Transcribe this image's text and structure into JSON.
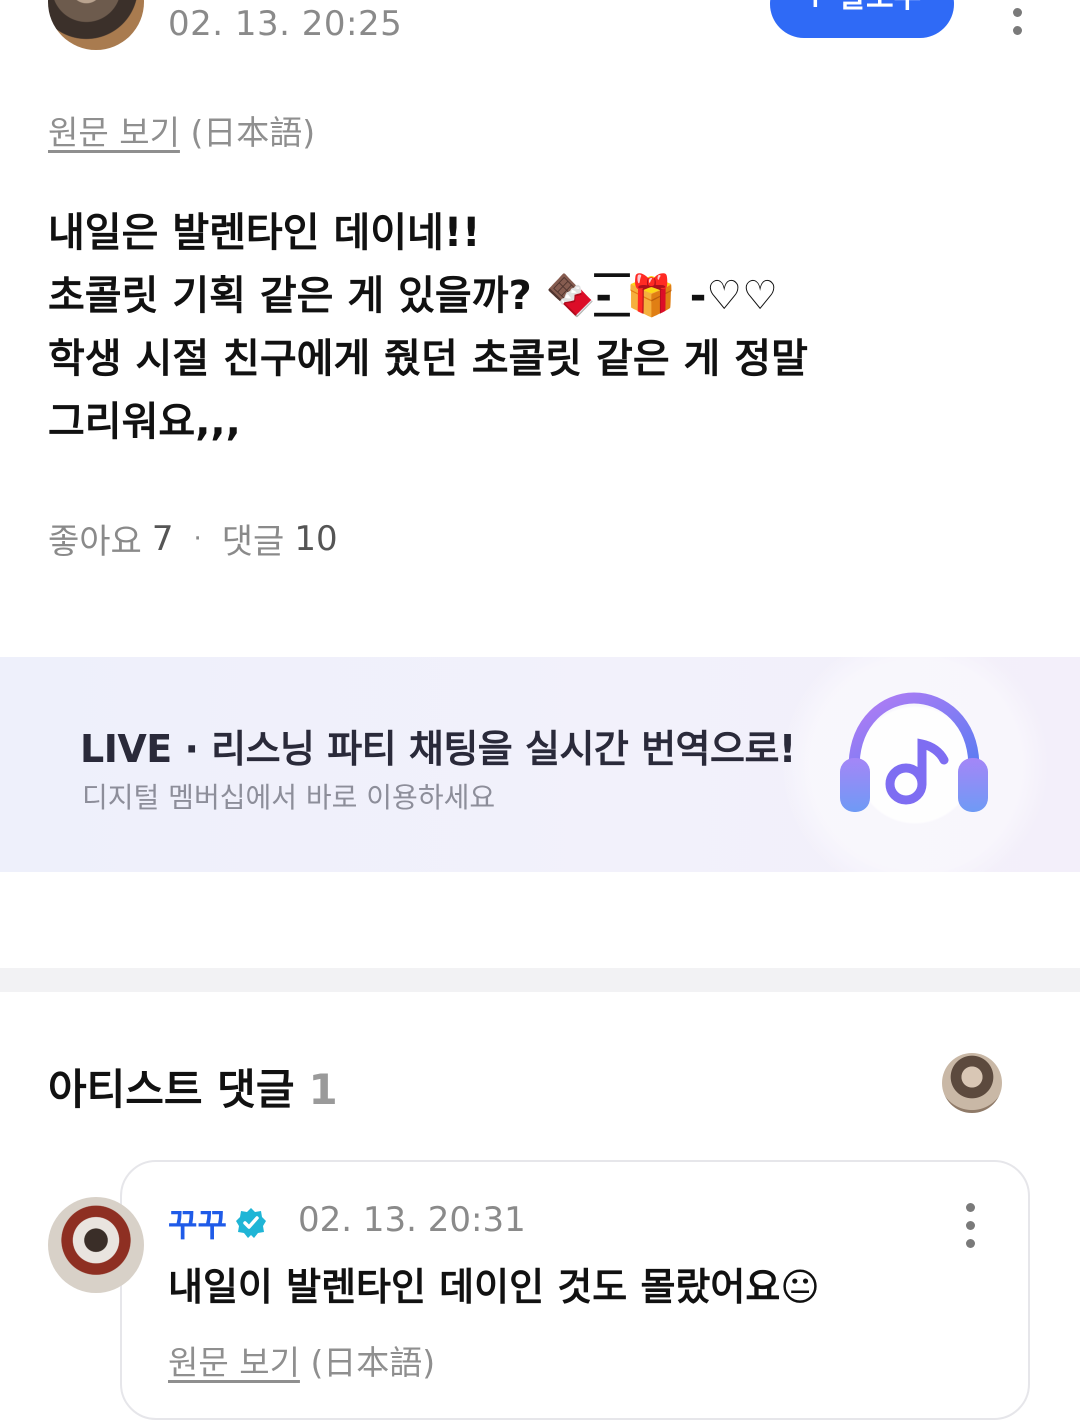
{
  "post": {
    "timestamp": "02. 13. 20:25",
    "follow_label": "+ 팔로우",
    "original_link": "원문 보기",
    "original_lang": "(日本語)",
    "body_lines": [
      "내일은 발렌타인 데이네!!",
      "초콜릿 기획 같은 게 있을까? 🍫-͟͟͞͞ 🎁 -♡♡",
      "학생 시절 친구에게 줬던 초콜릿 같은 게 정말",
      "그리워요,,,"
    ],
    "likes_label": "좋아요",
    "likes_count": "7",
    "separator": "·",
    "comments_label": "댓글",
    "comments_count": "10"
  },
  "banner": {
    "title": "LIVE · 리스닝 파티 채팅을 실시간 번역으로!",
    "subtitle": "디지털 멤버십에서 바로 이용하세요",
    "icon": "headphones-music-icon"
  },
  "artist_comments": {
    "title": "아티스트 댓글",
    "count": "1",
    "comment": {
      "author": "꾸꾸",
      "timestamp": "02. 13. 20:31",
      "text": "내일이 발렌타인 데이인 것도 몰랐어요😐",
      "original_link": "원문 보기",
      "original_lang": "(日本語)"
    }
  },
  "colors": {
    "accent": "#2f6af6",
    "author_name": "#1f5be8",
    "verified_badge": "#1fb5d6",
    "muted_text": "#8a8a8a"
  }
}
